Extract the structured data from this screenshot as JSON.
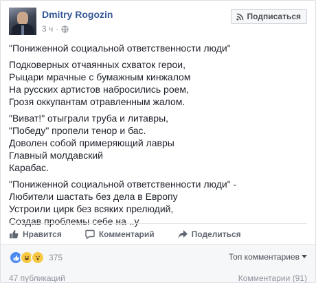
{
  "post": {
    "author": "Dmitry Rogozin",
    "time": "3 ч",
    "subscribe_label": "Подписаться",
    "title": "\"Пониженной социальной ответственности люди\"",
    "stanza1": [
      "Подковерных отчаянных схваток герои,",
      "Рыцари мрачные с бумажным кинжалом",
      "На русских артистов набросились роем,",
      "Грозя оккупантам отравленным жалом."
    ],
    "stanza2": [
      "\"Виват!\" отыграли труба и литавры,",
      "\"Победу\" пропели тенор и бас.",
      "Доволен собой примеряющий лавры",
      "Главный молдавский",
      "Карабас."
    ],
    "stanza3": [
      "\"Пониженной социальной ответственности люди\" -",
      "Любители шастать без дела в Европу",
      "Устроили цирк без всяких прелюдий,",
      "Создав проблемы себе на ..у"
    ]
  },
  "actions": {
    "like": "Нравится",
    "comment": "Комментарий",
    "share": "Поделиться"
  },
  "footer": {
    "reaction_count": "375",
    "sort_label": "Топ комментариев",
    "shares": "47 публикаций",
    "comments": "Комментарии (91)"
  },
  "icons": {
    "globe": "globe-icon",
    "rss": "rss-icon",
    "like": "thumbs-up-icon",
    "comment": "speech-bubble-icon",
    "share": "share-arrow-icon"
  },
  "colors": {
    "author": "#365899",
    "like_reaction": "#4d8af0",
    "haha_reaction": "#f7c944"
  }
}
